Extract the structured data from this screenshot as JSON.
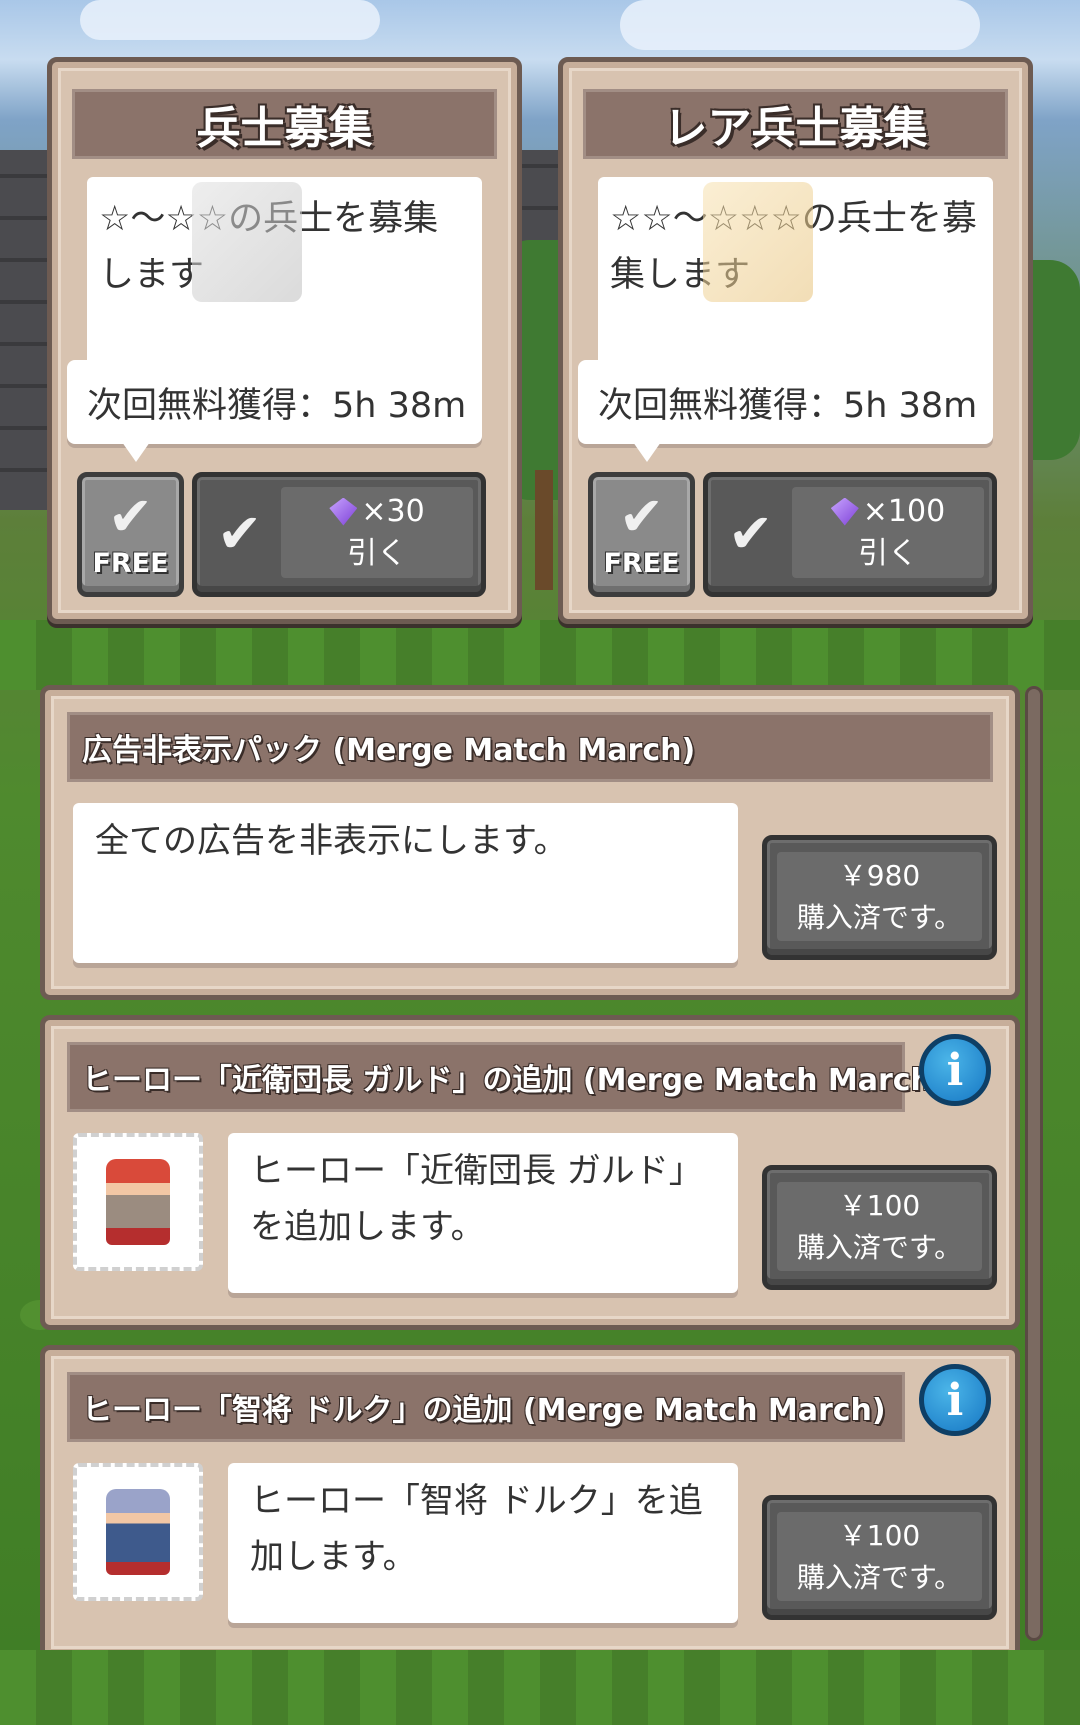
{
  "gacha": [
    {
      "title": "兵士募集",
      "desc": "☆〜☆☆の兵士を募集します",
      "timer": "次回無料獲得：5h 38m",
      "free_label": "FREE",
      "cost": "×30",
      "pull_label": "引く",
      "icon": "scroll-icon"
    },
    {
      "title": "レア兵士募集",
      "desc": "☆☆〜☆☆☆の兵士を募集します",
      "timer": "次回無料獲得：5h 38m",
      "free_label": "FREE",
      "cost": "×100",
      "pull_label": "引く",
      "icon": "golden-scroll-icon"
    }
  ],
  "shop": [
    {
      "title": "広告非表示パック (Merge Match March)",
      "desc": "全ての広告を非表示にします。",
      "price": "￥980",
      "status": "購入済です。"
    },
    {
      "title": "ヒーロー「近衛団長 ガルド」の追加 (Merge Match March)",
      "desc": "ヒーロー「近衛団長 ガルド」を追加します。",
      "price": "￥100",
      "status": "購入済です。",
      "portrait": "hero-gard-portrait"
    },
    {
      "title": "ヒーロー「智将 ドルク」の追加 (Merge Match March)",
      "desc": "ヒーロー「智将 ドルク」を追加します。",
      "price": "￥100",
      "status": "購入済です。",
      "portrait": "hero-dork-portrait"
    }
  ],
  "colors": {
    "panel": "#d8c3b0",
    "panel_border": "#6d5b52",
    "title_bar": "#8b736a",
    "button": "#595959",
    "info": "#1677c4"
  }
}
